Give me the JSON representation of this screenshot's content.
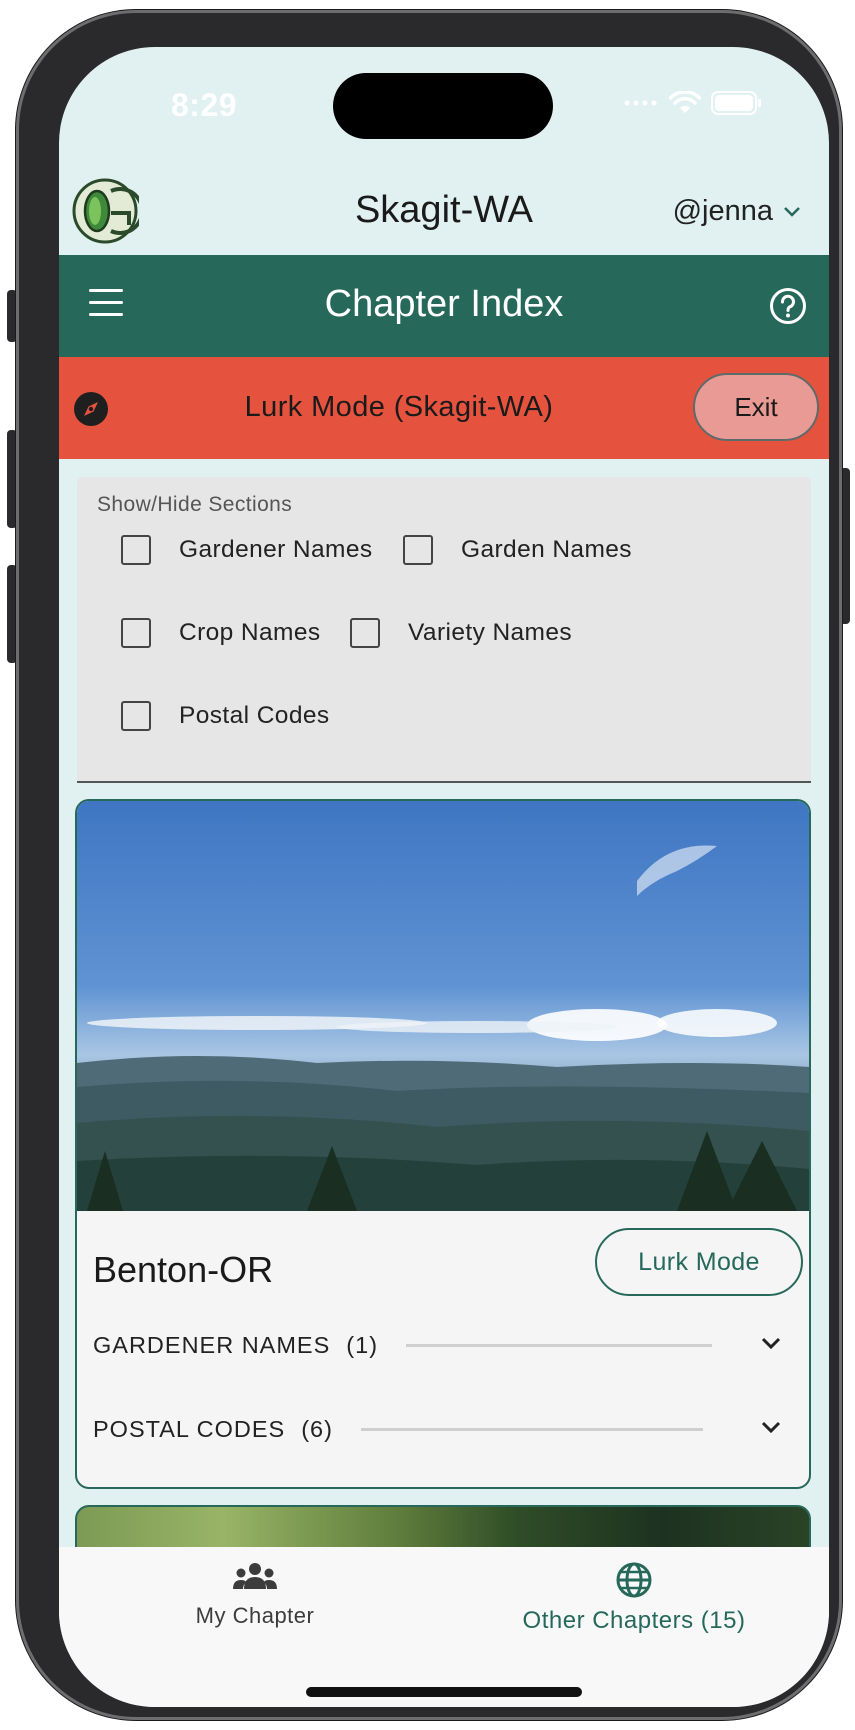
{
  "status": {
    "time": "8:29"
  },
  "topbar": {
    "chapter": "Skagit-WA",
    "user": "@jenna"
  },
  "header": {
    "title": "Chapter Index"
  },
  "lurk_banner": {
    "text": "Lurk Mode (Skagit-WA)",
    "exit_label": "Exit"
  },
  "show_hide": {
    "label": "Show/Hide Sections",
    "options": [
      {
        "label": "Gardener Names",
        "checked": false
      },
      {
        "label": "Garden Names",
        "checked": false
      },
      {
        "label": "Crop Names",
        "checked": false
      },
      {
        "label": "Variety Names",
        "checked": false
      },
      {
        "label": "Postal Codes",
        "checked": false
      }
    ]
  },
  "cards": [
    {
      "name": "Benton-OR",
      "lurk_label": "Lurk Mode",
      "sections": [
        {
          "label": "GARDENER NAMES",
          "count": "(1)"
        },
        {
          "label": "POSTAL CODES",
          "count": "(6)"
        }
      ]
    }
  ],
  "bottom_nav": [
    {
      "label": "My Chapter",
      "icon": "group-icon",
      "active": false
    },
    {
      "label": "Other Chapters (15)",
      "icon": "globe-icon",
      "active": true
    }
  ],
  "colors": {
    "primary": "#26695a",
    "lurk": "#e5533e",
    "exit": "#e99a94",
    "background": "#e1f0f0"
  }
}
